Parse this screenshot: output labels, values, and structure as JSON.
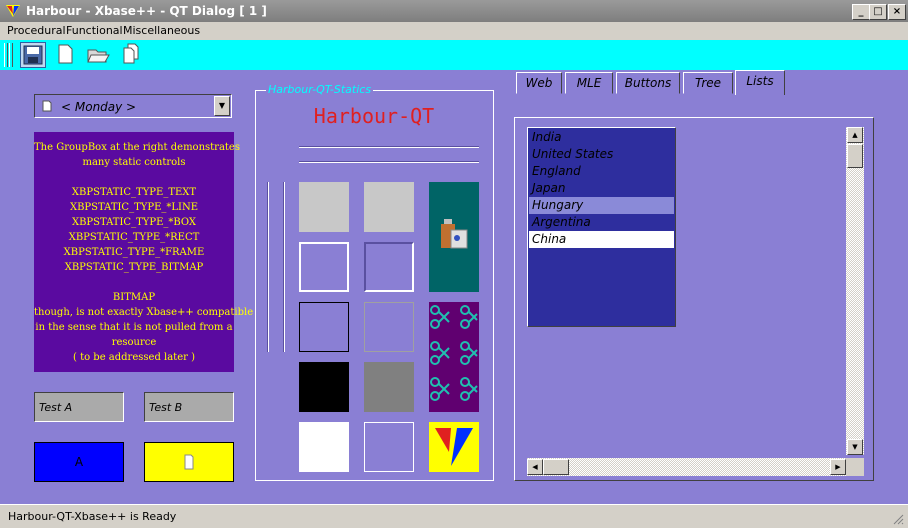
{
  "window": {
    "title": "Harbour - Xbase++ - QT Dialog  [ 1 ]",
    "min_glyph": "_",
    "max_glyph": "□",
    "close_glyph": "×"
  },
  "menu": [
    "Procedural",
    "Functional",
    "Miscellaneous"
  ],
  "combo": {
    "value": "< Monday >",
    "drop_glyph": "▼"
  },
  "description": {
    "lines": [
      "The GroupBox at the right demonstrates",
      "many static controls",
      "",
      "XBPSTATIC_TYPE_TEXT",
      "XBPSTATIC_TYPE_*LINE",
      "XBPSTATIC_TYPE_*BOX",
      "XBPSTATIC_TYPE_*RECT",
      "XBPSTATIC_TYPE_*FRAME",
      "XBPSTATIC_TYPE_BITMAP",
      "",
      "BITMAP",
      "though, is not exactly Xbase++ compatible",
      "in the sense that it is not pulled from a",
      "resource",
      "( to be addressed later )"
    ]
  },
  "sle": {
    "a": "Test A",
    "b": "Test B"
  },
  "buttons": {
    "a_label": "A",
    "a_color": "#0000ff",
    "b_color": "#ffff00"
  },
  "groupbox": {
    "title": "Harbour-QT-Statics",
    "text": "Harbour-QT",
    "text_color": "#e02020"
  },
  "tabs": [
    "Web",
    "MLE",
    "Buttons",
    "Tree",
    "Lists"
  ],
  "selected_tab": "Lists",
  "list": [
    "India",
    "United States",
    "England",
    "Japan",
    "Hungary",
    "Argentina",
    "China"
  ],
  "scroll_glyphs": {
    "up": "▲",
    "down": "▼",
    "left": "◀",
    "right": "▶"
  },
  "status": "Harbour-QT-Xbase++ is Ready"
}
